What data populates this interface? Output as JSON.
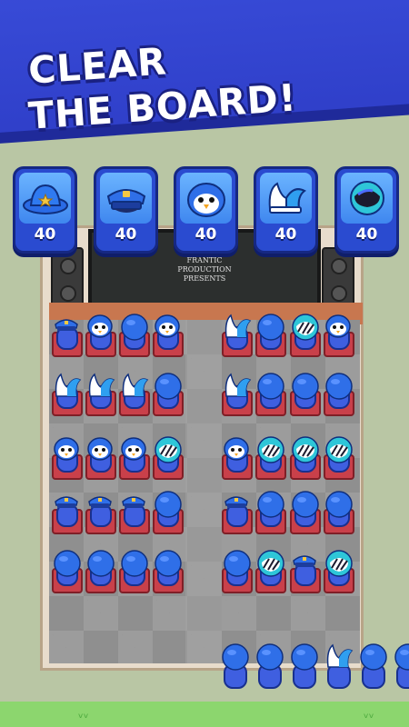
{
  "banner": {
    "line1": "CLEAR",
    "line2": "THE BOARD!"
  },
  "hats": [
    {
      "icon": "sheriff-hat-icon",
      "count": "40"
    },
    {
      "icon": "police-cap-icon",
      "count": "40"
    },
    {
      "icon": "penguin-hat-icon",
      "count": "40"
    },
    {
      "icon": "jester-hat-icon",
      "count": "40"
    },
    {
      "icon": "helmet-icon",
      "count": "40"
    }
  ],
  "screen": {
    "line1": "FRANTIC",
    "line2": "PRODUCTION",
    "line3": "PRESENTS"
  },
  "seat_rows": [
    [
      "police-cap",
      "penguin-hat",
      "blue-round",
      "penguin-hat",
      "",
      "jester-hat",
      "blue-round",
      "striped-helmet",
      "penguin-hat"
    ],
    [
      "jester-hat",
      "jester-hat",
      "jester-hat",
      "blue-round",
      "",
      "jester-hat",
      "blue-round",
      "blue-round",
      "blue-round"
    ],
    [
      "penguin-hat",
      "penguin-hat",
      "penguin-hat",
      "striped-helmet",
      "",
      "penguin-hat",
      "striped-helmet",
      "striped-helmet",
      "striped-helmet"
    ],
    [
      "police-cap",
      "police-cap",
      "police-cap",
      "blue-round",
      "",
      "police-cap",
      "blue-round",
      "blue-round",
      "blue-round"
    ],
    [
      "blue-round",
      "blue-round",
      "blue-round",
      "blue-round",
      "",
      "blue-round",
      "striped-helmet",
      "police-cap",
      "striped-helmet"
    ]
  ],
  "queue": [
    "blue-round",
    "blue-round",
    "blue-round",
    "jester-hat",
    "blue-round",
    "blue-round"
  ],
  "colors": {
    "banner": "#3b4fdc",
    "card": "#2a4bd0",
    "seat": "#c9404a",
    "grass": "#8cd66e"
  }
}
